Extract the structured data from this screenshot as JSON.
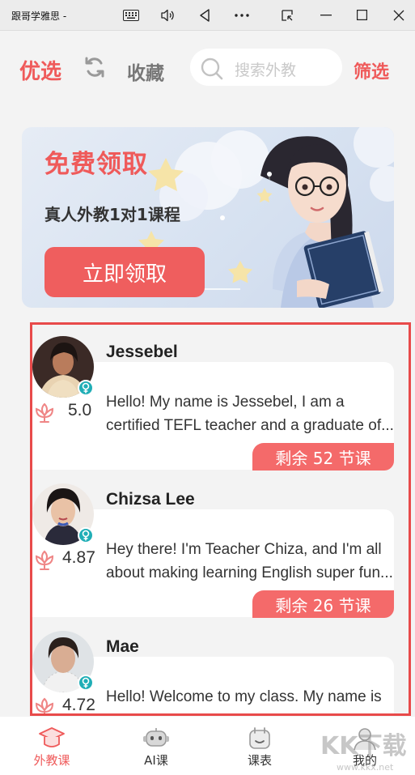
{
  "window": {
    "title": "跟哥学雅思 -"
  },
  "header": {
    "tab_recommended": "优选",
    "tab_favorites": "收藏",
    "search_placeholder": "搜索外教",
    "filter_label": "筛选"
  },
  "banner": {
    "title": "免费领取",
    "subtitle": "真人外教1对1课程",
    "cta": "立即领取"
  },
  "teachers": [
    {
      "name": "Jessebel",
      "rating": "5.0",
      "intro": "Hello! My name is Jessebel, I am a certified TEFL teacher and a graduate of...",
      "lessons_left": "剩余 52 节课"
    },
    {
      "name": "Chizsa Lee",
      "rating": "4.87",
      "intro": "Hey there! I'm Teacher Chiza, and I'm all about making learning English super fun...",
      "lessons_left": "剩余 26 节课"
    },
    {
      "name": "Mae",
      "rating": "4.72",
      "intro": "Hello! Welcome to my class. My name is Mae Tan. I have been teaching English...",
      "lessons_left": ""
    }
  ],
  "nav": {
    "items": [
      {
        "label": "外教课",
        "icon": "graduation-cap-icon",
        "active": true
      },
      {
        "label": "AI课",
        "icon": "robot-icon",
        "active": false
      },
      {
        "label": "课表",
        "icon": "calendar-icon",
        "active": false
      },
      {
        "label": "我的",
        "icon": "profile-icon",
        "active": false
      }
    ]
  },
  "watermark": {
    "text": "KK下载",
    "url": "www.kkx.net"
  },
  "colors": {
    "accent": "#ef5a5a",
    "badge_teal": "#20aeb6",
    "highlight_border": "#e84a4a"
  }
}
